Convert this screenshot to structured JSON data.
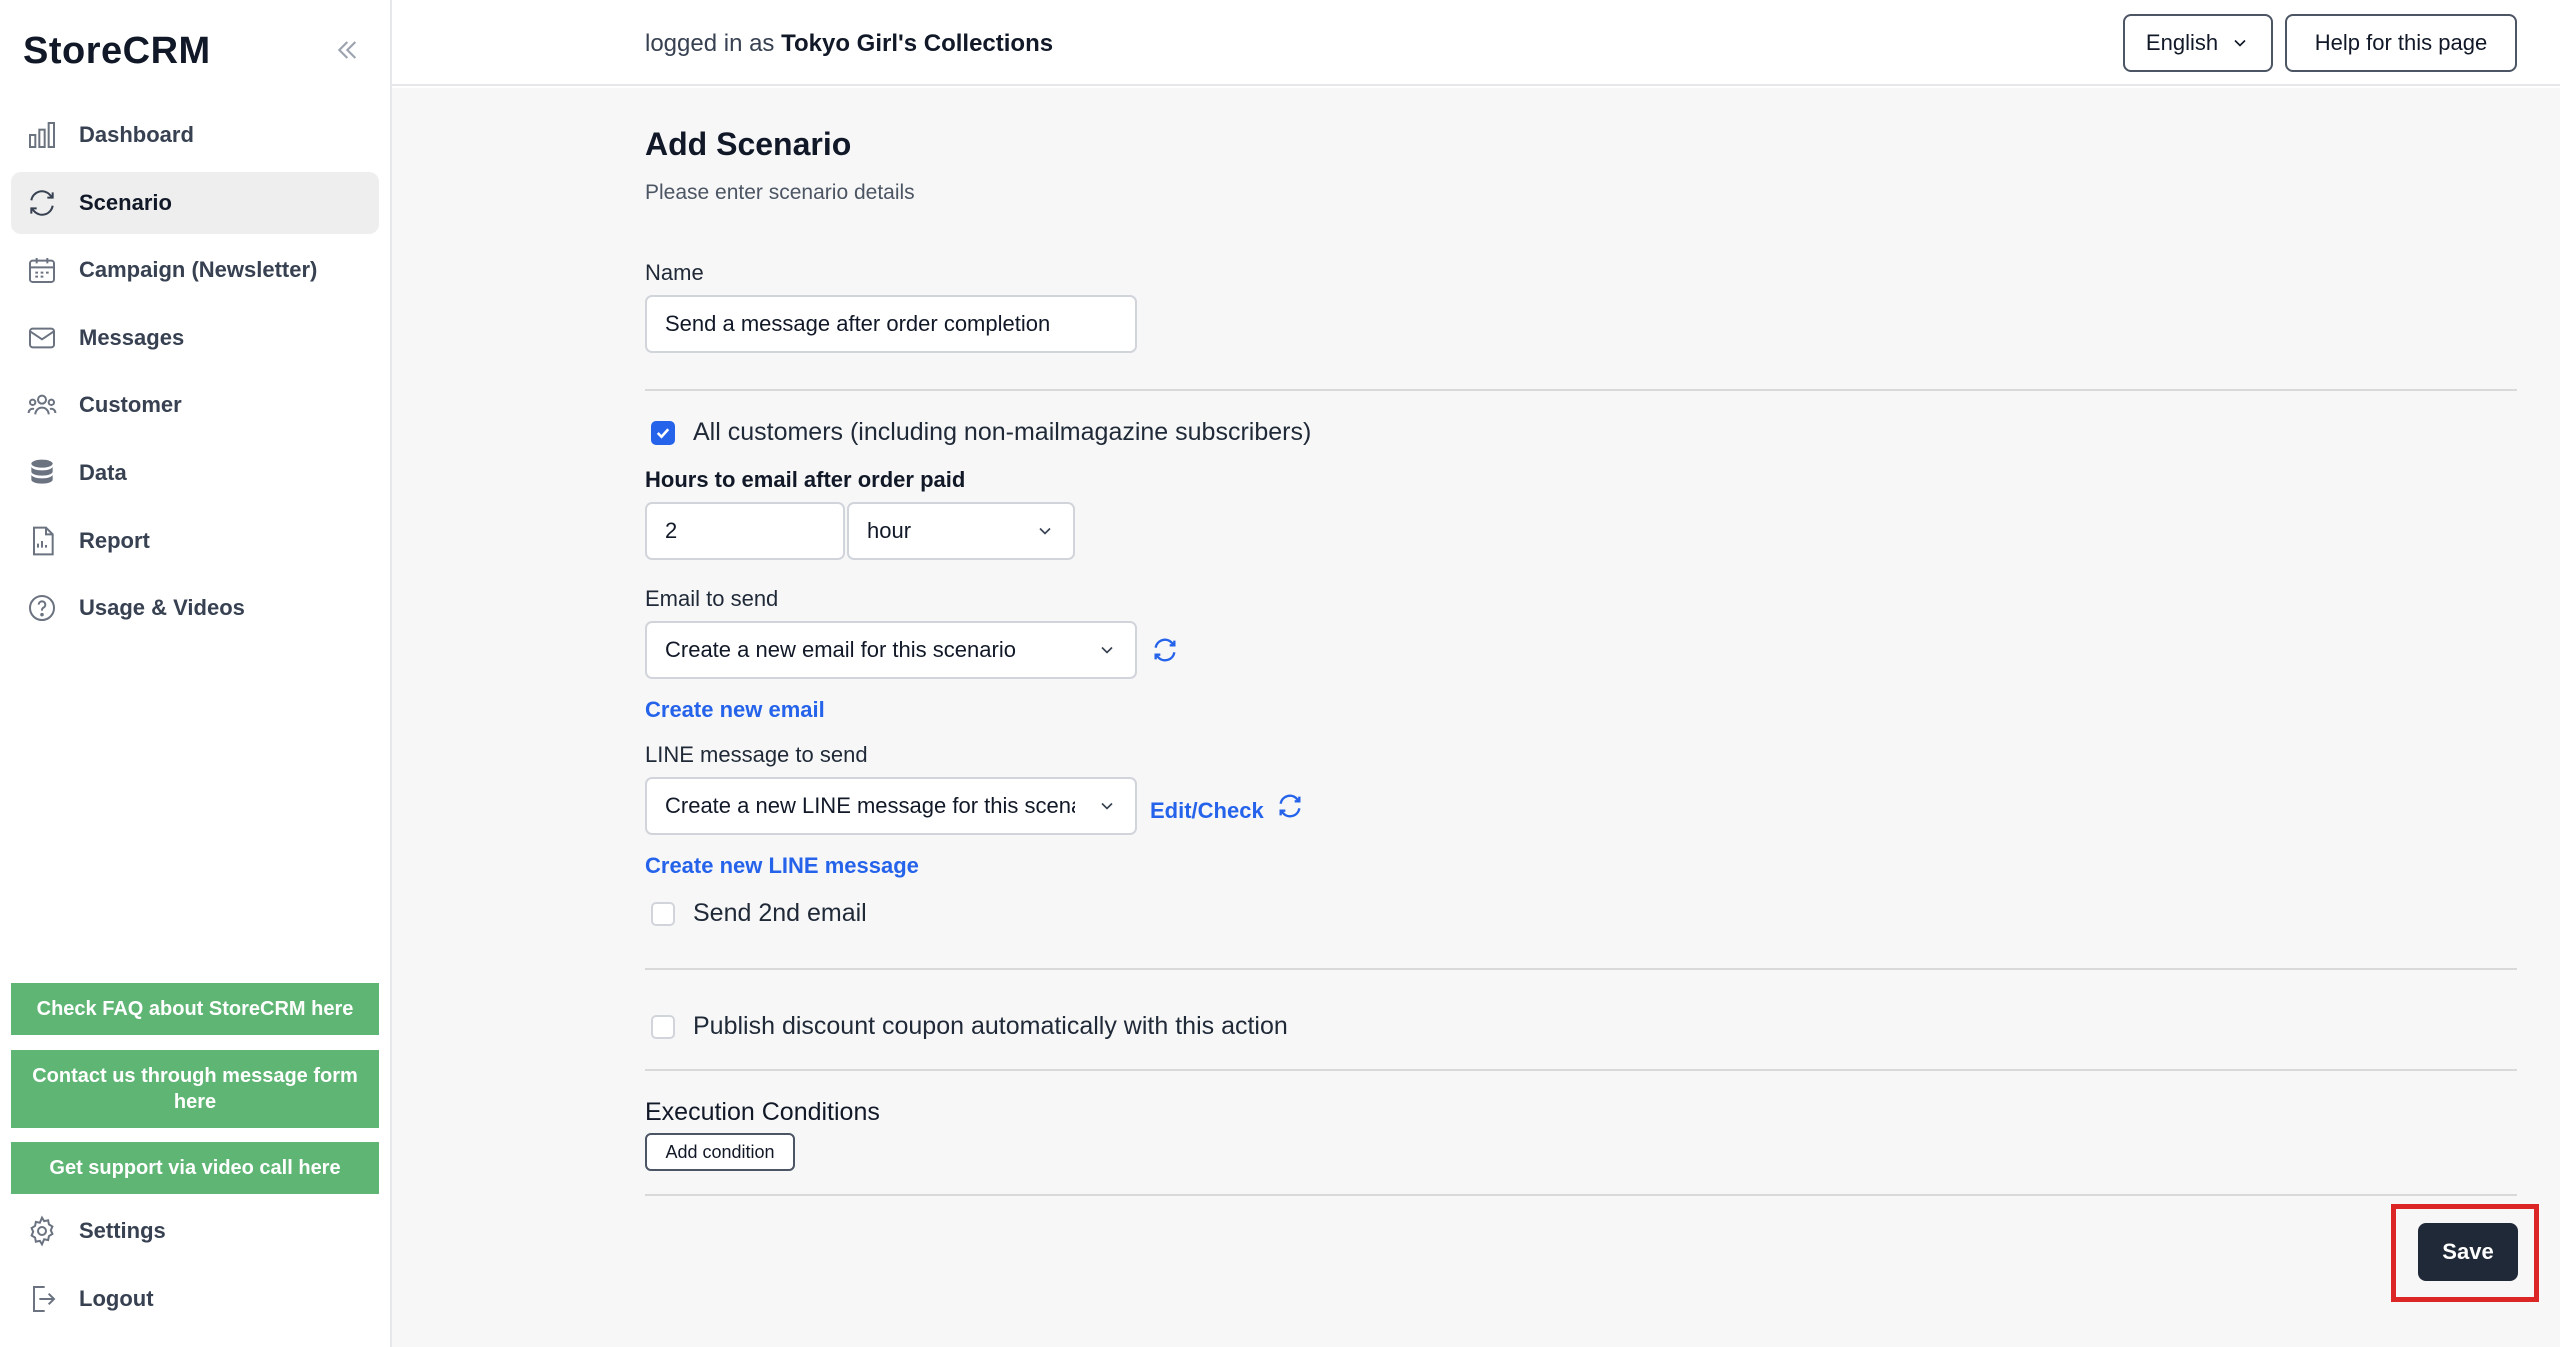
{
  "app": {
    "name": "StoreCRM"
  },
  "sidebar": {
    "items": [
      {
        "label": "Dashboard",
        "icon": "bar-chart-icon"
      },
      {
        "label": "Scenario",
        "icon": "refresh-cycle-icon",
        "active": true
      },
      {
        "label": "Campaign (Newsletter)",
        "icon": "calendar-icon"
      },
      {
        "label": "Messages",
        "icon": "envelope-icon"
      },
      {
        "label": "Customer",
        "icon": "users-icon"
      },
      {
        "label": "Data",
        "icon": "database-icon"
      },
      {
        "label": "Report",
        "icon": "document-icon"
      },
      {
        "label": "Usage & Videos",
        "icon": "help-circle-icon"
      }
    ],
    "support_buttons": [
      "Check FAQ about StoreCRM here",
      "Contact us through message form here",
      "Get support via video call here"
    ],
    "bottom_items": [
      {
        "label": "Settings",
        "icon": "gear-icon"
      },
      {
        "label": "Logout",
        "icon": "logout-icon"
      }
    ]
  },
  "header": {
    "login_prefix": "logged in as",
    "store_name": "Tokyo Girl's Collections",
    "language": "English",
    "help_button": "Help for this page"
  },
  "form": {
    "title": "Add Scenario",
    "subtitle": "Please enter scenario details",
    "name_label": "Name",
    "name_value": "Send a message after order completion",
    "all_customers_label": "All customers (including non-mailmagazine subscribers)",
    "all_customers_checked": true,
    "hours_label": "Hours to email after order paid",
    "hours_value": "2",
    "hours_unit": "hour",
    "email_label": "Email to send",
    "email_value": "Create a new email for this scenario",
    "create_email_link": "Create new email",
    "line_label": "LINE message to send",
    "line_value": "Create a new LINE message for this scenario",
    "edit_check_link": "Edit/Check",
    "create_line_link": "Create new LINE message",
    "second_email_label": "Send 2nd email",
    "second_email_checked": false,
    "coupon_label": "Publish discount coupon automatically with this action",
    "coupon_checked": false,
    "conditions_title": "Execution Conditions",
    "add_condition_button": "Add condition",
    "save_button": "Save"
  },
  "colors": {
    "accent": "#2563eb",
    "support_green": "#5fb574",
    "save_dark": "#1f2937",
    "highlight_red": "#dc2626"
  }
}
